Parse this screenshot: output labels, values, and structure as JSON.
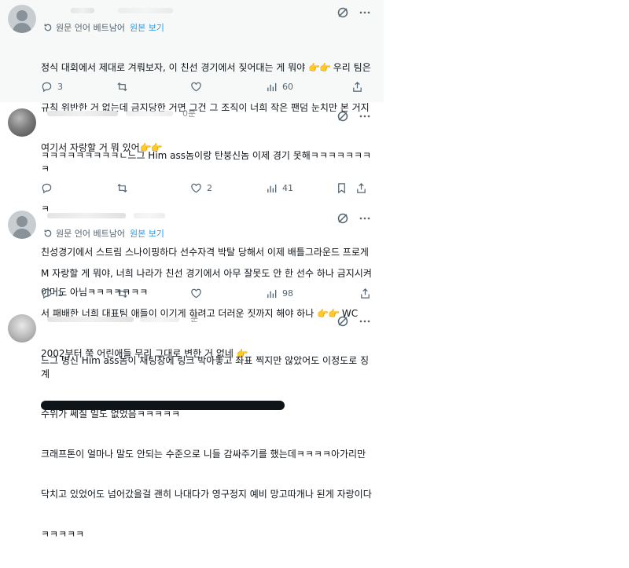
{
  "translate": {
    "note": "원문 언어 베트남어",
    "link": "원본 보기"
  },
  "posts": [
    {
      "time_fragment": "",
      "body_lines": [
        "정식 대회에서 제대로 겨뤄보자, 이 친선 경기에서 짖어대는 게 뭐야",
        "규칙 위반한 거 없는데 금지당한 거면 그건 그 조직이 너희 작은 팬덤 눈치만 본 거지",
        "여기서 자랑할 거 뭐 있어"
      ],
      "replies": "3",
      "likes": "",
      "views": "60",
      "emojis": [
        "👉👉",
        "👉👉"
      ]
    },
    {
      "time_fragment": "0분",
      "body_lines": [
        "ㅋㅋㅋㅋㅋㅋㅋㅋㅋㄴ느그 Him ass놈이랑 탄붕신놈 이제 경기 못해ㅋㅋㅋㅋㅋㅋㅋㅋ",
        "ㅋ",
        "친성경기에서 스트림 스나이핑하다 선수자격 박탈 당해서 이제 배틀그라운드 프로게",
        "이머도 아님ㅋㅋㅋㅋㅋㅋㅋ"
      ],
      "replies": "",
      "likes": "2",
      "views": "41"
    },
    {
      "time_fragment": "",
      "body_lines": [
        "M 자랑할 게 뭐야, 너희 나라가 친선 경기에서 아무 잘못도 안 한 선수 하나 금지시켜",
        "서 패배한 너희 대표팀 애들이 이기게 하려고 더러운 짓까지 해야 하나",
        "2002부터 쭉 어린애들 무리 그대로 변한 거 없네"
      ],
      "replies": "1",
      "likes": "",
      "views": "98",
      "emojis": [
        "👉👉",
        "👉"
      ],
      "line2_suffix": "WC"
    },
    {
      "time_fragment": "분",
      "body_lines": [
        "느그 병신 Him ass놈이 채팅창에 링크 박아놓고 좌표 찍지만 않았어도 이정도로 징계",
        "수위가 쎄질 일도 없었음ㅋㅋㅋㅋㅋ",
        "크래프톤이 얼마나 말도 안되는 수준으로 니들 감싸주기를 했는데ㅋㅋㅋㅋ아가리만",
        "닥치고 있었어도 넘어갔을걸 괜히 나대다가 영구정지 예비 망고따개나 된게 자랑이다",
        "ㅋㅋㅋㅋㅋ"
      ]
    }
  ]
}
